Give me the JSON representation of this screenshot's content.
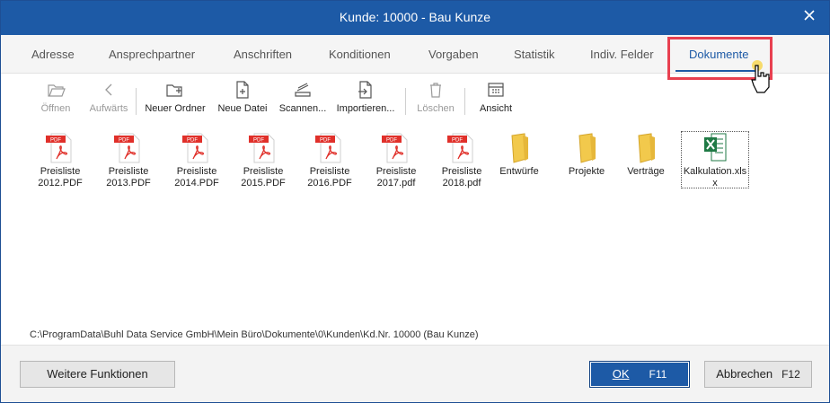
{
  "window": {
    "title": "Kunde: 10000 - Bau Kunze"
  },
  "tabs": [
    {
      "label": "Adresse"
    },
    {
      "label": "Ansprechpartner"
    },
    {
      "label": "Anschriften"
    },
    {
      "label": "Konditionen"
    },
    {
      "label": "Vorgaben"
    },
    {
      "label": "Statistik"
    },
    {
      "label": "Indiv. Felder"
    },
    {
      "label": "Dokumente",
      "active": true
    }
  ],
  "toolbar": {
    "open": "Öffnen",
    "up": "Aufwärts",
    "new_folder": "Neuer Ordner",
    "new_file": "Neue Datei",
    "scan": "Scannen...",
    "import": "Importieren...",
    "delete": "Löschen",
    "view": "Ansicht"
  },
  "files": [
    {
      "name": "Preisliste 2012.PDF",
      "type": "pdf"
    },
    {
      "name": "Preisliste 2013.PDF",
      "type": "pdf"
    },
    {
      "name": "Preisliste 2014.PDF",
      "type": "pdf"
    },
    {
      "name": "Preisliste 2015.PDF",
      "type": "pdf"
    },
    {
      "name": "Preisliste 2016.PDF",
      "type": "pdf"
    },
    {
      "name": "Preisliste 2017.pdf",
      "type": "pdf"
    },
    {
      "name": "Preisliste 2018.pdf",
      "type": "pdf"
    },
    {
      "name": "Entwürfe",
      "type": "folder"
    },
    {
      "name": "Projekte",
      "type": "folder"
    },
    {
      "name": "Verträge",
      "type": "folder"
    },
    {
      "name": "Kalkulation.xlsx",
      "type": "xlsx",
      "selected": true
    }
  ],
  "pdf_badge": "PDF",
  "path": "C:\\ProgramData\\Buhl Data Service GmbH\\Mein Büro\\Dokumente\\0\\Kunden\\Kd.Nr. 10000 (Bau Kunze)",
  "footer": {
    "more": "Weitere Funktionen",
    "ok": "OK",
    "ok_key": "F11",
    "cancel": "Abbrechen",
    "cancel_key": "F12"
  },
  "colors": {
    "accent": "#1d5aa6",
    "highlight": "#e84050",
    "pdf": "#e0302a",
    "folder": "#f2c94c",
    "excel": "#1f7a45"
  },
  "icons": [
    "open-folder-icon",
    "arrow-left-icon",
    "new-folder-icon",
    "new-file-icon",
    "scanner-icon",
    "import-icon",
    "trash-icon",
    "view-grid-icon",
    "pdf-icon",
    "folder-icon",
    "excel-icon",
    "close-icon",
    "hand-cursor-icon"
  ]
}
